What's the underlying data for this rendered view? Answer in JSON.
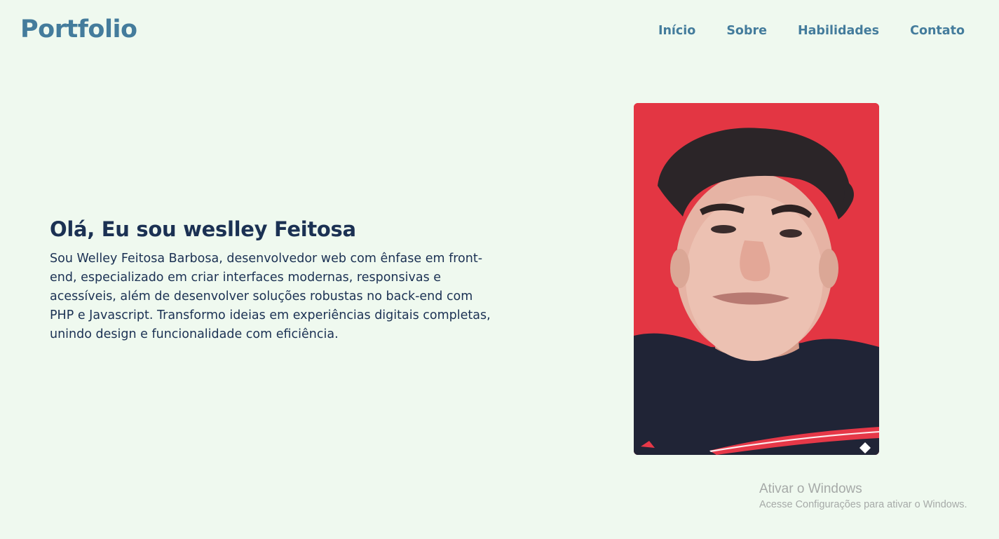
{
  "header": {
    "logo": "Portfolio",
    "nav": [
      {
        "label": "Início"
      },
      {
        "label": "Sobre"
      },
      {
        "label": "Habilidades"
      },
      {
        "label": "Contato"
      }
    ]
  },
  "hero": {
    "title": "Olá, Eu sou weslley Feitosa",
    "description": "Sou Welley Feitosa Barbosa, desenvolvedor web com ênfase em front-end, especializado em criar interfaces modernas, responsivas e acessíveis, além de desenvolver soluções robustas no back-end com PHP e Javascript. Transformo ideias em experiências digitais completas, unindo design e funcionalidade com eficiência."
  },
  "windows_activation": {
    "title": "Ativar o Windows",
    "subtitle": "Acesse Configurações para ativar o Windows."
  },
  "colors": {
    "background": "#eff9ef",
    "accent": "#447c9c",
    "heading": "#1b3153",
    "photo_background": "#e33643"
  }
}
